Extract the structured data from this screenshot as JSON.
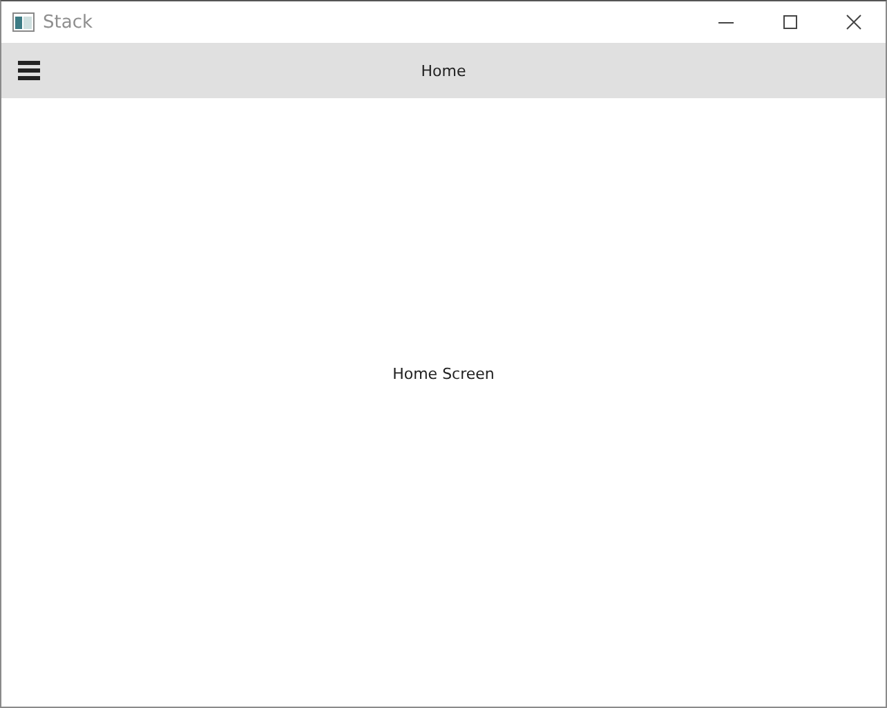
{
  "window": {
    "title": "Stack"
  },
  "toolbar": {
    "title": "Home"
  },
  "screen": {
    "text": "Home Screen"
  }
}
